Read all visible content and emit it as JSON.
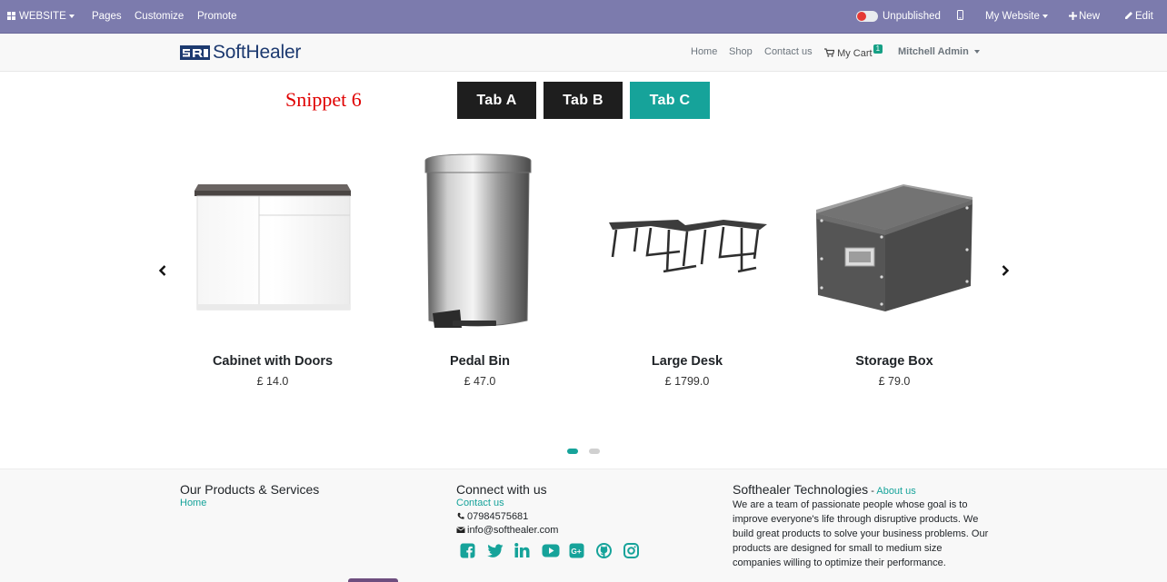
{
  "admin_bar": {
    "website": "WEBSITE",
    "pages": "Pages",
    "customize": "Customize",
    "promote": "Promote",
    "publish_status": "Unpublished",
    "site_selector": "My Website",
    "new": "New",
    "edit": "Edit"
  },
  "header": {
    "logo_text": "SoftHealer",
    "nav": {
      "home": "Home",
      "shop": "Shop",
      "contact": "Contact us",
      "cart": "My Cart",
      "cart_count": "1",
      "user": "Mitchell Admin"
    }
  },
  "snippet": {
    "title": "Snippet 6",
    "tabs": [
      "Tab A",
      "Tab B",
      "Tab C"
    ],
    "active_tab": "Tab C"
  },
  "products": [
    {
      "name": "Cabinet with Doors",
      "price": "£ 14.0",
      "icon": "cabinet-image"
    },
    {
      "name": "Pedal Bin",
      "price": "£ 47.0",
      "icon": "pedal-bin-image"
    },
    {
      "name": "Large Desk",
      "price": "£ 1799.0",
      "icon": "desk-image"
    },
    {
      "name": "Storage Box",
      "price": "£ 79.0",
      "icon": "storage-box-image"
    }
  ],
  "carousel": {
    "pages": 2,
    "active_page": 1
  },
  "footer": {
    "products_title": "Our Products & Services",
    "products_link": "Home",
    "connect_title": "Connect with us",
    "contact_link": "Contact us",
    "phone": "07984575681",
    "email": "info@softhealer.com",
    "company_title": "Softhealer Technologies",
    "company_sep": " - ",
    "about_link": "About us",
    "about_text": "We are a team of passionate people whose goal is to improve everyone's life through disruptive products. We build great products to solve your business problems. Our products are designed for small to medium size companies willing to optimize their performance.",
    "social": [
      "facebook-icon",
      "twitter-icon",
      "linkedin-icon",
      "youtube-icon",
      "google-plus-icon",
      "github-icon",
      "instagram-icon"
    ]
  },
  "colors": {
    "admin_bar": "#7c7bad",
    "accent": "#16a39a",
    "dark_tab": "#1e1e1e",
    "snippet_title": "#e00000"
  }
}
